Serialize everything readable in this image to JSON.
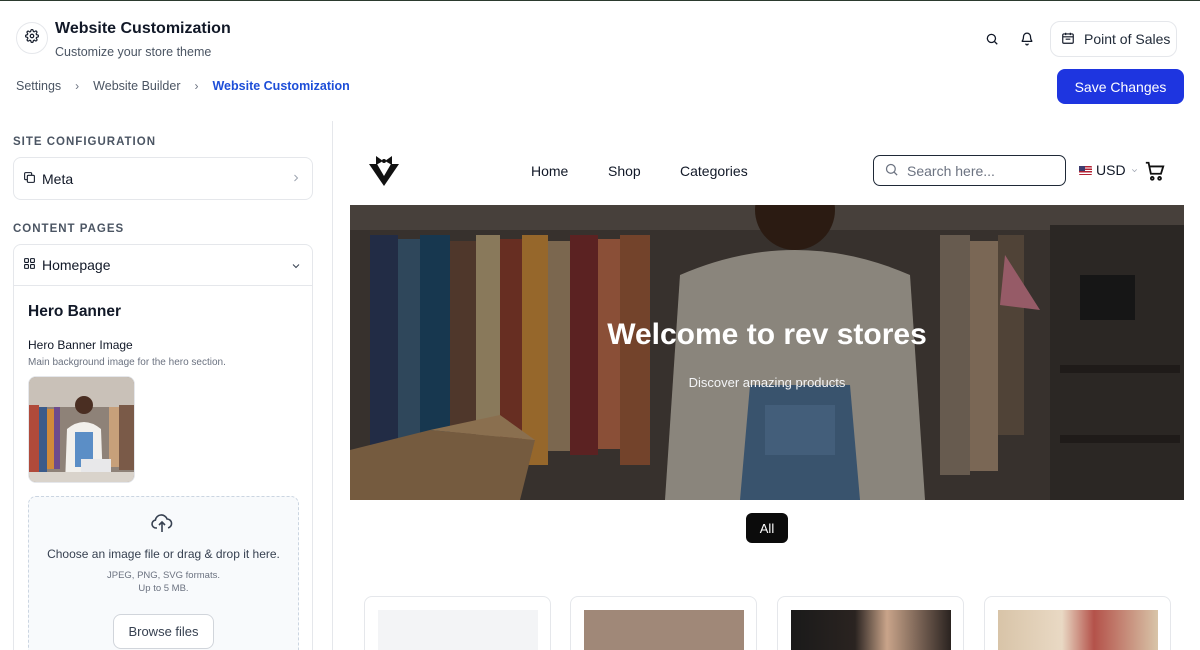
{
  "header": {
    "title": "Website Customization",
    "subtitle": "Customize your store theme",
    "pos_label": "Point of Sales",
    "save_label": "Save Changes"
  },
  "breadcrumb": [
    "Settings",
    "Website Builder",
    "Website Customization"
  ],
  "sidebar": {
    "site_config_label": "SITE CONFIGURATION",
    "meta_label": "Meta",
    "content_pages_label": "CONTENT PAGES",
    "homepage_label": "Homepage",
    "hero_banner": {
      "title": "Hero Banner",
      "image_label": "Hero Banner Image",
      "image_desc": "Main background image for the hero section.",
      "dropzone_main": "Choose an image file or drag & drop it here.",
      "dropzone_formats": "JPEG, PNG, SVG formats.",
      "dropzone_size": "Up to 5 MB.",
      "browse_label": "Browse files"
    }
  },
  "preview": {
    "nav": [
      "Home",
      "Shop",
      "Categories"
    ],
    "search_placeholder": "Search here...",
    "currency": "USD",
    "hero_title": "Welcome to rev stores",
    "hero_subtitle": "Discover amazing products",
    "filter_chip": "All"
  },
  "colors": {
    "accent": "#1e35e0",
    "breadcrumb_active": "#1d4ed8",
    "chip_bg": "#0b0b0b"
  }
}
